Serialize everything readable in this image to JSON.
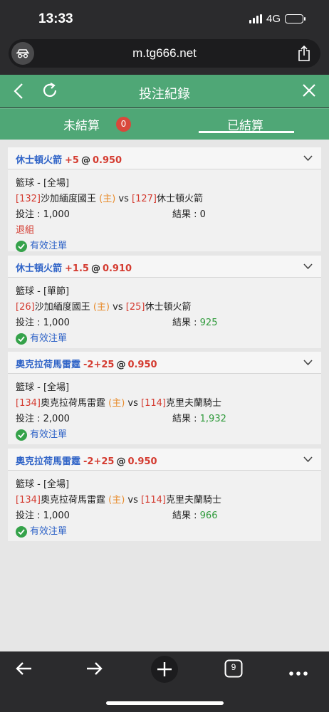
{
  "status": {
    "time": "13:33",
    "network": "4G"
  },
  "browser": {
    "url": "m.tg666.net",
    "tabs_count": "9"
  },
  "header": {
    "title": "投注紀錄"
  },
  "tabs": {
    "unsettled": "未結算",
    "unsettled_count": "0",
    "settled": "已結算"
  },
  "labels": {
    "vs": "vs",
    "at": "@"
  },
  "bets": [
    {
      "team": "休士頓火箭",
      "line": "+5",
      "odds": "0.950",
      "sport": "籃球 - [全場]",
      "home_id": "[132]",
      "home": "沙加緬度國王",
      "home_tag": "(主)",
      "away_id": "[127]",
      "away": "休士頓火箭",
      "stake": "投注 : 1,000",
      "result_label": "結果 : ",
      "result_value": "0",
      "note": "退組",
      "status": "有效注單"
    },
    {
      "team": "休士頓火箭",
      "line": "+1.5",
      "odds": "0.910",
      "sport": "籃球 - [單節]",
      "home_id": "[26]",
      "home": "沙加緬度國王",
      "home_tag": "(主)",
      "away_id": "[25]",
      "away": "休士頓火箭",
      "stake": "投注 : 1,000",
      "result_label": "結果 : ",
      "result_value": "925",
      "status": "有效注單"
    },
    {
      "team": "奧克拉荷馬雷霆",
      "line": "-2+25",
      "odds": "0.950",
      "sport": "籃球 - [全場]",
      "home_id": "[134]",
      "home": "奧克拉荷馬雷霆",
      "home_tag": "(主)",
      "away_id": "[114]",
      "away": "克里夫蘭騎士",
      "stake": "投注 : 2,000",
      "result_label": "結果 : ",
      "result_value": "1,932",
      "status": "有效注單"
    },
    {
      "team": "奧克拉荷馬雷霆",
      "line": "-2+25",
      "odds": "0.950",
      "sport": "籃球 - [全場]",
      "home_id": "[134]",
      "home": "奧克拉荷馬雷霆",
      "home_tag": "(主)",
      "away_id": "[114]",
      "away": "克里夫蘭騎士",
      "stake": "投注 : 1,000",
      "result_label": "結果 : ",
      "result_value": "966",
      "status": "有效注單"
    }
  ]
}
